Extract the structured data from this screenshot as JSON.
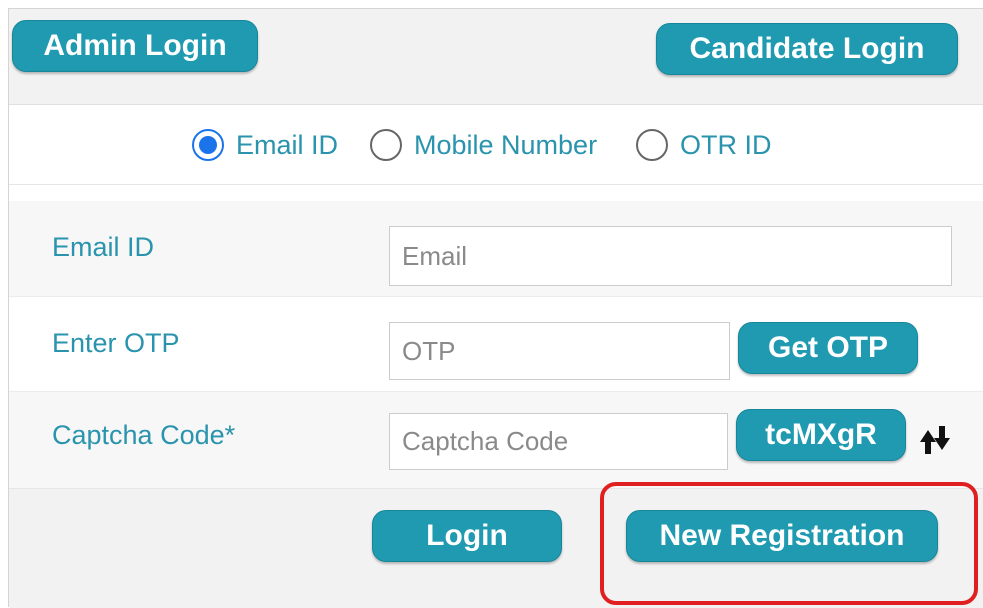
{
  "header": {
    "admin_login": "Admin Login",
    "candidate_login": "Candidate Login"
  },
  "login_method": {
    "options": [
      "Email ID",
      "Mobile Number",
      "OTR ID"
    ],
    "selected": "Email ID"
  },
  "form": {
    "email_label": "Email ID",
    "email_placeholder": "Email",
    "email_value": "",
    "otp_label": "Enter OTP",
    "otp_placeholder": "OTP",
    "otp_value": "",
    "get_otp": "Get OTP",
    "captcha_label": "Captcha Code*",
    "captcha_placeholder": "Captcha Code",
    "captcha_value": "",
    "captcha_code": "tcMXgR",
    "refresh_icon": "refresh-arrows-icon"
  },
  "actions": {
    "login": "Login",
    "new_registration": "New Registration"
  },
  "colors": {
    "button": "#1f9ab0",
    "label": "#2a93ad",
    "radio_selected": "#1a73e8",
    "highlight": "#e02020"
  }
}
